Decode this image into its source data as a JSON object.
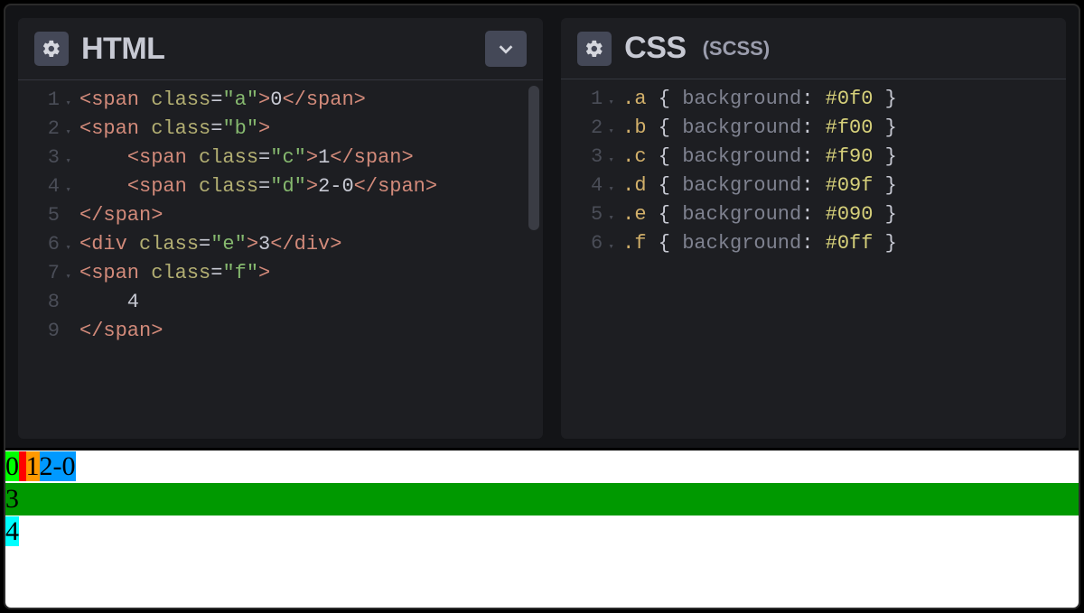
{
  "panes": {
    "html": {
      "title": "HTML",
      "lines": [
        {
          "n": "1",
          "fold": true,
          "tokens": [
            [
              "tag",
              "<span "
            ],
            [
              "attr",
              "class"
            ],
            [
              "punct",
              "="
            ],
            [
              "str",
              "\"a\""
            ],
            [
              "tag",
              ">"
            ],
            [
              "txt",
              "0"
            ],
            [
              "tag",
              "</span>"
            ]
          ]
        },
        {
          "n": "2",
          "fold": true,
          "tokens": [
            [
              "tag",
              "<span "
            ],
            [
              "attr",
              "class"
            ],
            [
              "punct",
              "="
            ],
            [
              "str",
              "\"b\""
            ],
            [
              "tag",
              ">"
            ]
          ]
        },
        {
          "n": "3",
          "fold": true,
          "tokens": [
            [
              "txt",
              "    "
            ],
            [
              "tag",
              "<span "
            ],
            [
              "attr",
              "class"
            ],
            [
              "punct",
              "="
            ],
            [
              "str",
              "\"c\""
            ],
            [
              "tag",
              ">"
            ],
            [
              "txt",
              "1"
            ],
            [
              "tag",
              "</span>"
            ]
          ]
        },
        {
          "n": "4",
          "fold": true,
          "tokens": [
            [
              "txt",
              "    "
            ],
            [
              "tag",
              "<span "
            ],
            [
              "attr",
              "class"
            ],
            [
              "punct",
              "="
            ],
            [
              "str",
              "\"d\""
            ],
            [
              "tag",
              ">"
            ],
            [
              "txt",
              "2-0"
            ],
            [
              "tag",
              "</span>"
            ]
          ]
        },
        {
          "n": "5",
          "fold": false,
          "tokens": [
            [
              "tag",
              "</span>"
            ]
          ]
        },
        {
          "n": "6",
          "fold": true,
          "tokens": [
            [
              "tag",
              "<div "
            ],
            [
              "attr",
              "class"
            ],
            [
              "punct",
              "="
            ],
            [
              "str",
              "\"e\""
            ],
            [
              "tag",
              ">"
            ],
            [
              "txt",
              "3"
            ],
            [
              "tag",
              "</div>"
            ]
          ]
        },
        {
          "n": "7",
          "fold": true,
          "tokens": [
            [
              "tag",
              "<span "
            ],
            [
              "attr",
              "class"
            ],
            [
              "punct",
              "="
            ],
            [
              "str",
              "\"f\""
            ],
            [
              "tag",
              ">"
            ]
          ]
        },
        {
          "n": "8",
          "fold": false,
          "tokens": [
            [
              "txt",
              "    4"
            ]
          ]
        },
        {
          "n": "9",
          "fold": false,
          "tokens": [
            [
              "tag",
              "</span>"
            ]
          ]
        }
      ]
    },
    "css": {
      "title": "CSS",
      "subtitle": "(SCSS)",
      "lines": [
        {
          "n": "1",
          "fold": true,
          "tokens": [
            [
              "sel",
              ".a "
            ],
            [
              "brace",
              "{ "
            ],
            [
              "prop",
              "background"
            ],
            [
              "punct",
              ": "
            ],
            [
              "val",
              "#0f0"
            ],
            [
              "brace",
              " }"
            ]
          ]
        },
        {
          "n": "2",
          "fold": true,
          "tokens": [
            [
              "sel",
              ".b "
            ],
            [
              "brace",
              "{ "
            ],
            [
              "prop",
              "background"
            ],
            [
              "punct",
              ": "
            ],
            [
              "val",
              "#f00"
            ],
            [
              "brace",
              " }"
            ]
          ]
        },
        {
          "n": "3",
          "fold": true,
          "tokens": [
            [
              "sel",
              ".c "
            ],
            [
              "brace",
              "{ "
            ],
            [
              "prop",
              "background"
            ],
            [
              "punct",
              ": "
            ],
            [
              "val",
              "#f90"
            ],
            [
              "brace",
              " }"
            ]
          ]
        },
        {
          "n": "4",
          "fold": true,
          "tokens": [
            [
              "sel",
              ".d "
            ],
            [
              "brace",
              "{ "
            ],
            [
              "prop",
              "background"
            ],
            [
              "punct",
              ": "
            ],
            [
              "val",
              "#09f"
            ],
            [
              "brace",
              " }"
            ]
          ]
        },
        {
          "n": "5",
          "fold": true,
          "tokens": [
            [
              "sel",
              ".e "
            ],
            [
              "brace",
              "{ "
            ],
            [
              "prop",
              "background"
            ],
            [
              "punct",
              ": "
            ],
            [
              "val",
              "#090"
            ],
            [
              "brace",
              " }"
            ]
          ]
        },
        {
          "n": "6",
          "fold": true,
          "tokens": [
            [
              "sel",
              ".f "
            ],
            [
              "brace",
              "{ "
            ],
            [
              "prop",
              "background"
            ],
            [
              "punct",
              ": "
            ],
            [
              "val",
              "#0ff"
            ],
            [
              "brace",
              " }"
            ]
          ]
        }
      ]
    }
  },
  "output": {
    "a": "0",
    "b_space": " ",
    "c": "1",
    "d": "2-0",
    "e": "3",
    "f": "4"
  }
}
